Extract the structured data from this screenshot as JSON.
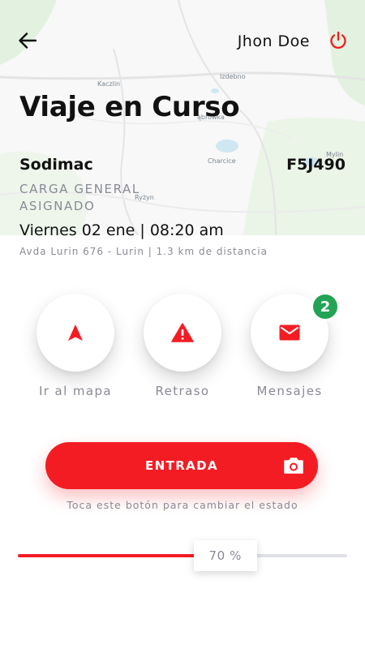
{
  "header": {
    "user_name": "Jhon Doe",
    "back_icon": "arrow-left-icon",
    "power_icon": "power-icon"
  },
  "map": {
    "labels": {
      "kaczlin": "Kaczlin",
      "izdebno": "Izdebno",
      "charcice": "Charcice",
      "mylin": "Mylin",
      "ryzyn": "Ryżyn",
      "dabrowka": "ąbrowka"
    }
  },
  "trip": {
    "title": "Viaje en Curso",
    "company": "Sodimac",
    "plate": "F5J490",
    "cargo_line1": "CARGA GENERAL",
    "cargo_line2": "ASIGNADO",
    "datetime": "Viernes 02 ene | 08:20 am",
    "address": "Avda Lurin 676 - Lurin | 1.3 km de distancia"
  },
  "actions": {
    "map": {
      "label": "Ir al mapa",
      "icon": "navigation-arrow-icon"
    },
    "delay": {
      "label": "Retraso",
      "icon": "warning-icon"
    },
    "messages": {
      "label": "Mensajes",
      "icon": "mail-icon",
      "badge": "2"
    }
  },
  "status": {
    "button_label": "ENTRADA",
    "camera_icon": "camera-icon",
    "hint": "Toca este botón para cambiar el estado"
  },
  "progress": {
    "value": 70,
    "label": "70 %"
  },
  "colors": {
    "accent": "#f41c23",
    "badge": "#23a455",
    "muted_text": "#8a8a94",
    "track": "#dfe1e6"
  }
}
